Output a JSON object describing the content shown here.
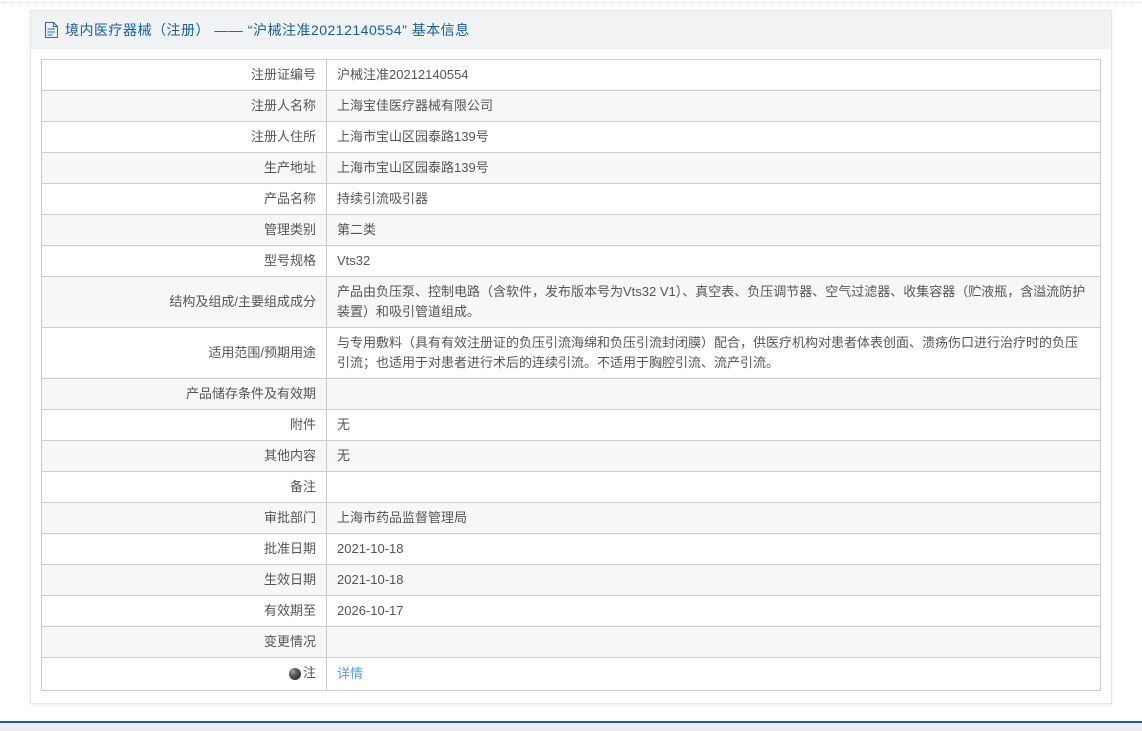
{
  "header": {
    "icon": "document-icon",
    "title": "境内医疗器械（注册） —— “沪械注准20212140554” 基本信息"
  },
  "colors": {
    "title_blue": "#17609f",
    "link_blue": "#5a9bd5",
    "row_stripe": "#f7f7f7",
    "table_border": "#cccccc",
    "header_bg": "#f0f2f4",
    "footer_line": "#1a6199"
  },
  "table": {
    "rows": [
      {
        "label": "注册证编号",
        "value": "沪械注准20212140554"
      },
      {
        "label": "注册人名称",
        "value": "上海宝佳医疗器械有限公司"
      },
      {
        "label": "注册人住所",
        "value": "上海市宝山区园泰路139号"
      },
      {
        "label": "生产地址",
        "value": "上海市宝山区园泰路139号"
      },
      {
        "label": "产品名称",
        "value": "持续引流吸引器"
      },
      {
        "label": "管理类别",
        "value": "第二类"
      },
      {
        "label": "型号规格",
        "value": "Vts32"
      },
      {
        "label": "结构及组成/主要组成成分",
        "value": "产品由负压泵、控制电路（含软件，发布版本号为Vts32 V1）、真空表、负压调节器、空气过滤器、收集容器（贮液瓶，含溢流防护装置）和吸引管道组成。"
      },
      {
        "label": "适用范围/预期用途",
        "value": "与专用敷料（具有有效注册证的负压引流海绵和负压引流封闭膜）配合，供医疗机构对患者体表创面、溃疡伤口进行治疗时的负压引流；也适用于对患者进行术后的连续引流。不适用于胸腔引流、流产引流。"
      },
      {
        "label": "产品储存条件及有效期",
        "value": ""
      },
      {
        "label": "附件",
        "value": "无"
      },
      {
        "label": "其他内容",
        "value": "无"
      },
      {
        "label": "备注",
        "value": ""
      },
      {
        "label": "审批部门",
        "value": "上海市药品监督管理局"
      },
      {
        "label": "批准日期",
        "value": "2021-10-18"
      },
      {
        "label": "生效日期",
        "value": "2021-10-18"
      },
      {
        "label": "有效期至",
        "value": "2026-10-17"
      },
      {
        "label": "变更情况",
        "value": ""
      }
    ],
    "note_row": {
      "icon": "bulb-icon",
      "label": "注",
      "link_label": "详情"
    }
  }
}
